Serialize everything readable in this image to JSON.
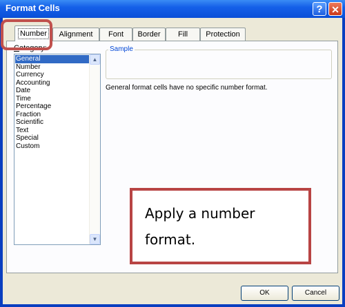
{
  "window": {
    "title": "Format Cells",
    "help_label": "?",
    "close_label": "✕"
  },
  "tabs": [
    {
      "label": "Number",
      "active": true
    },
    {
      "label": "Alignment",
      "active": false
    },
    {
      "label": "Font",
      "active": false
    },
    {
      "label": "Border",
      "active": false
    },
    {
      "label": "Fill",
      "active": false
    },
    {
      "label": "Protection",
      "active": false
    }
  ],
  "number_tab": {
    "category_label_accel": "C",
    "category_label_rest": "ategory:",
    "categories": [
      "General",
      "Number",
      "Currency",
      "Accounting",
      "Date",
      "Time",
      "Percentage",
      "Fraction",
      "Scientific",
      "Text",
      "Special",
      "Custom"
    ],
    "selected_category": "General",
    "sample_label": "Sample",
    "description": "General format cells have no specific number format."
  },
  "callout": {
    "text": "Apply a number format."
  },
  "buttons": {
    "ok": "OK",
    "cancel": "Cancel"
  },
  "colors": {
    "title_bar": "#1560e8",
    "dialog_face": "#ece9d8",
    "selection": "#316ac5",
    "callout_border": "#b84444",
    "highlight_border": "#c0504d"
  }
}
